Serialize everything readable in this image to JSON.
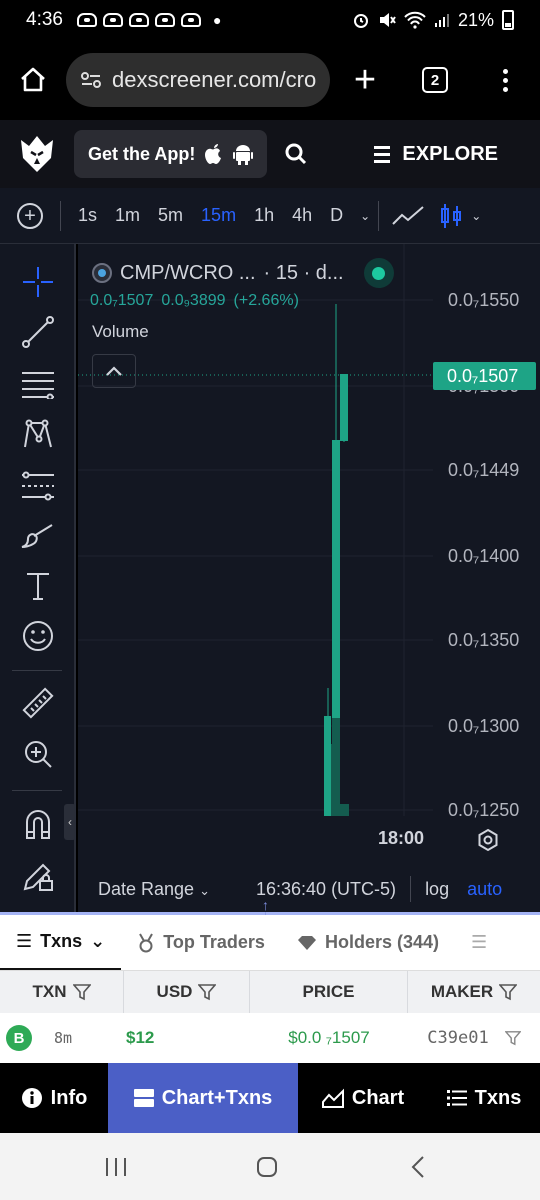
{
  "status_bar": {
    "time": "4:36",
    "battery": "21%",
    "notification_icons": [
      "app-notification-icon",
      "app-notification-icon",
      "app-notification-icon",
      "app-notification-icon",
      "app-notification-icon"
    ]
  },
  "browser": {
    "url": "dexscreener.com/cro",
    "tab_count": "2"
  },
  "site_header": {
    "get_app_label": "Get the App!",
    "explore_label": "EXPLORE"
  },
  "timeframes": {
    "items": [
      "1s",
      "1m",
      "5m",
      "15m",
      "1h",
      "4h",
      "D"
    ],
    "active": "15m"
  },
  "chart": {
    "pair_title": "CMP/WCRO ...",
    "interval_label": "· 15 · d...",
    "last_price": "0.0₇1507",
    "change_abs": "0.0₉3899",
    "change_pct": "(+2.66%)",
    "volume_label": "Volume",
    "price_axis": [
      "0.0₇1550",
      "0.0₇1500",
      "0.0₇1449",
      "0.0₇1400",
      "0.0₇1350",
      "0.0₇1300",
      "0.0₇1250"
    ],
    "current_price_tag": "0.0₇1507",
    "time_axis_label": "18:00",
    "footer": {
      "date_range": "Date Range",
      "clock": "16:36:40 (UTC-5)",
      "log": "log",
      "auto": "auto"
    },
    "colors": {
      "up": "#1ea486",
      "background": "#131722",
      "accent": "#2962ff"
    }
  },
  "tabs": {
    "txns": "Txns",
    "top_traders": "Top Traders",
    "holders": "Holders (344)"
  },
  "table": {
    "headers": [
      "TXN",
      "USD",
      "PRICE",
      "MAKER"
    ],
    "rows": [
      {
        "type": "B",
        "age": "8m",
        "usd": "$12",
        "price": "$0.0 ₇1507",
        "maker": "C39e01"
      }
    ]
  },
  "bottom_nav": {
    "info": "Info",
    "chart_txns": "Chart+Txns",
    "chart": "Chart",
    "txns": "Txns"
  }
}
